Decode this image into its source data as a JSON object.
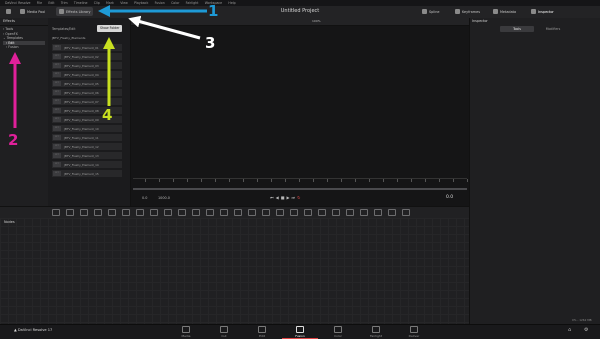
{
  "menubar": {
    "items": [
      "DaVinci Resolve",
      "File",
      "Edit",
      "Trim",
      "Timeline",
      "Clip",
      "Mark",
      "View",
      "Playback",
      "Fusion",
      "Color",
      "Fairlight",
      "Workspace",
      "Help"
    ]
  },
  "topbar": {
    "project_title": "Untitled Project",
    "media_pool": "Media Pool",
    "effects_library": "Effects Library",
    "spline": "Spline",
    "keyframes": "Keyframes",
    "metadata": "Metadata",
    "inspector": "Inspector"
  },
  "effects": {
    "title": "Effects",
    "tree": [
      "Tools",
      "OpenFX",
      "Templates",
      "Edit",
      "Fusion"
    ],
    "selected_index": 3
  },
  "contents": {
    "header": "Templates/Edit",
    "tooltip": "Show Folder",
    "items": [
      "JBTV_Flashy_Elements",
      "JBTV_Flashy_Element_01",
      "JBTV_Flashy_Element_02",
      "JBTV_Flashy_Element_03",
      "JBTV_Flashy_Element_04",
      "JBTV_Flashy_Element_05",
      "JBTV_Flashy_Element_06",
      "JBTV_Flashy_Element_07",
      "JBTV_Flashy_Element_08",
      "JBTV_Flashy_Element_09",
      "JBTV_Flashy_Element_10",
      "JBTV_Flashy_Element_11",
      "JBTV_Flashy_Element_12",
      "JBTV_Flashy_Element_13",
      "JBTV_Flashy_Element_14",
      "JBTV_Flashy_Element_15"
    ]
  },
  "viewer": {
    "zoom": "100%",
    "frame_start": "0.0",
    "frame_end": "1000.0",
    "current_frame": "0.0"
  },
  "inspector": {
    "title": "Inspector",
    "tabs": [
      "Tools",
      "Modifiers"
    ]
  },
  "nodes": {
    "title": "Nodes"
  },
  "bottombar": {
    "app_name": "DaVinci Resolve 17",
    "pages": [
      "Media",
      "Cut",
      "Edit",
      "Fusion",
      "Color",
      "Fairlight",
      "Deliver"
    ],
    "active_page": "Fusion",
    "memory": "0% - 1262 MB"
  },
  "annotations": {
    "labels": [
      "1",
      "2",
      "3",
      "4"
    ],
    "colors": [
      "#1e9ad6",
      "#e0209a",
      "#ffffff",
      "#c8e020"
    ]
  }
}
